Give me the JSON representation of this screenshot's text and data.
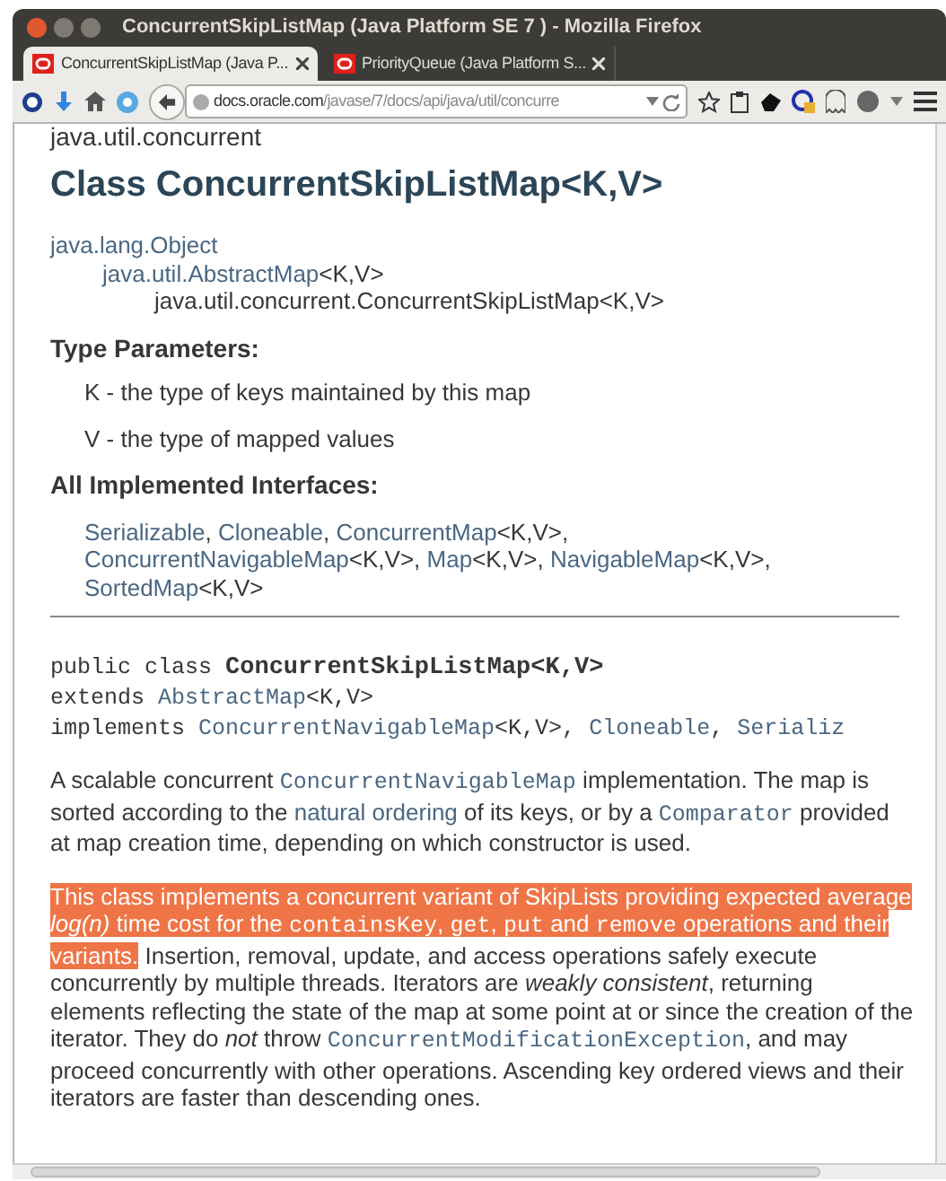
{
  "window": {
    "title": "ConcurrentSkipListMap (Java Platform SE 7 ) - Mozilla Firefox"
  },
  "tabs": [
    {
      "label": "ConcurrentSkipListMap (Java P...",
      "selected": true
    },
    {
      "label": "PriorityQueue (Java Platform S...",
      "selected": false
    }
  ],
  "url_bar": {
    "host": "docs.oracle.com",
    "path": "/javase/7/docs/api/java/util/concurre"
  },
  "page": {
    "package": "java.util.concurrent",
    "title": "Class ConcurrentSkipListMap<K,V>",
    "inheritance": {
      "segments": [
        {
          "kind": "link",
          "text": "java.lang.Object"
        }
      ],
      "children": [
        {
          "segments": [
            {
              "kind": "link",
              "text": "java.util.AbstractMap"
            },
            {
              "kind": "plain",
              "text": "<K,V>"
            }
          ],
          "children": [
            {
              "segments": [
                {
                  "kind": "plain",
                  "text": "java.util.concurrent.ConcurrentSkipListMap<K,V>"
                }
              ]
            }
          ]
        }
      ]
    },
    "type_parameters": {
      "heading": "Type Parameters:",
      "items": [
        "K - the type of keys maintained by this map",
        "V - the type of mapped values"
      ]
    },
    "interfaces": {
      "heading": "All Implemented Interfaces:",
      "segments": [
        {
          "kind": "link",
          "text": "Serializable"
        },
        {
          "kind": "plain",
          "text": ", "
        },
        {
          "kind": "link",
          "text": "Cloneable"
        },
        {
          "kind": "plain",
          "text": ", "
        },
        {
          "kind": "link",
          "text": "ConcurrentMap"
        },
        {
          "kind": "plain",
          "text": "<K,V>, "
        },
        {
          "kind": "link",
          "text": "ConcurrentNavigableMap"
        },
        {
          "kind": "plain",
          "text": "<K,V>, "
        },
        {
          "kind": "link",
          "text": "Map"
        },
        {
          "kind": "plain",
          "text": "<K,V>, "
        },
        {
          "kind": "link",
          "text": "NavigableMap"
        },
        {
          "kind": "plain",
          "text": "<K,V>, "
        },
        {
          "kind": "link",
          "text": "SortedMap"
        },
        {
          "kind": "plain",
          "text": "<K,V>"
        }
      ]
    },
    "signature": [
      [
        {
          "kind": "code",
          "text": "public class "
        },
        {
          "kind": "code_bold",
          "text": "ConcurrentSkipListMap<K,V>"
        }
      ],
      [
        {
          "kind": "code",
          "text": "extends "
        },
        {
          "kind": "code_link",
          "text": "AbstractMap"
        },
        {
          "kind": "code",
          "text": "<K,V>"
        }
      ],
      [
        {
          "kind": "code",
          "text": "implements "
        },
        {
          "kind": "code_link",
          "text": "ConcurrentNavigableMap"
        },
        {
          "kind": "code",
          "text": "<K,V>, "
        },
        {
          "kind": "code_link",
          "text": "Cloneable"
        },
        {
          "kind": "code",
          "text": ", "
        },
        {
          "kind": "code_link",
          "text": "Serializ"
        }
      ]
    ],
    "description": [
      {
        "runs": [
          {
            "highlighted": false,
            "segments": [
              {
                "kind": "plain",
                "text": "A scalable concurrent "
              },
              {
                "kind": "code_link",
                "text": "ConcurrentNavigableMap"
              },
              {
                "kind": "plain",
                "text": " implementation. The map is sorted according to the "
              },
              {
                "kind": "link",
                "text": "natural ordering"
              },
              {
                "kind": "plain",
                "text": " of its keys, or by a "
              },
              {
                "kind": "code_link",
                "text": "Comparator"
              },
              {
                "kind": "plain",
                "text": " provided at map creation time, depending on which constructor is used."
              }
            ]
          }
        ]
      },
      {
        "runs": [
          {
            "highlighted": true,
            "segments": [
              {
                "kind": "plain",
                "text": "This class implements a concurrent variant of SkipLists providing expected average "
              },
              {
                "kind": "italic",
                "text": "log(n)"
              },
              {
                "kind": "plain",
                "text": " time cost for the "
              },
              {
                "kind": "code",
                "text": "containsKey"
              },
              {
                "kind": "plain",
                "text": ", "
              },
              {
                "kind": "code",
                "text": "get"
              },
              {
                "kind": "plain",
                "text": ", "
              },
              {
                "kind": "code",
                "text": "put"
              },
              {
                "kind": "plain",
                "text": " and "
              },
              {
                "kind": "code",
                "text": "remove"
              },
              {
                "kind": "plain",
                "text": " operations and their variants."
              }
            ]
          },
          {
            "highlighted": false,
            "segments": [
              {
                "kind": "plain",
                "text": " Insertion, removal, update, and access operations safely execute concurrently by multiple threads. Iterators are "
              },
              {
                "kind": "italic",
                "text": "weakly consistent"
              },
              {
                "kind": "plain",
                "text": ", returning elements reflecting the state of the map at some point at or since the creation of the iterator. They do "
              },
              {
                "kind": "italic",
                "text": "not"
              },
              {
                "kind": "plain",
                "text": " throw "
              },
              {
                "kind": "code_link",
                "text": "ConcurrentModificationException"
              },
              {
                "kind": "plain",
                "text": ", and may proceed concurrently with other operations. Ascending key ordered views and their iterators are faster than descending ones."
              }
            ]
          }
        ]
      }
    ]
  }
}
